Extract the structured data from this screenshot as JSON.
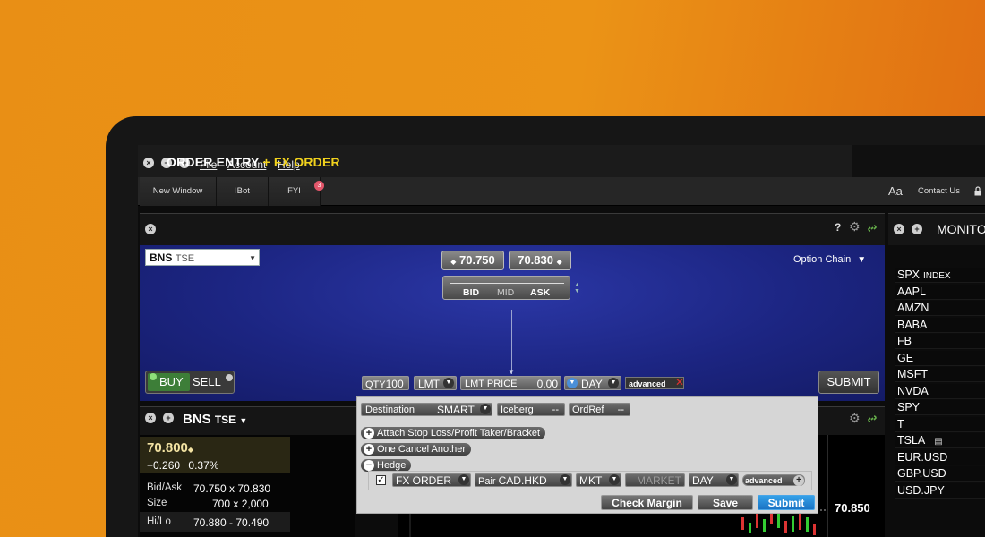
{
  "menu": {
    "file": "File",
    "account": "Account",
    "help": "Help"
  },
  "window_controls": {
    "close": "×",
    "minimize": "−",
    "maximize": "+"
  },
  "toolbar": {
    "new_window": "New Window",
    "ibot": "IBot",
    "fyi": "FYI",
    "fyi_badge": "3",
    "font_size": "Aa",
    "contact_us": "Contact Us"
  },
  "order_entry": {
    "title": "ORDER ENTRY",
    "fx_title": "+ FX ORDER",
    "help": "?",
    "symbol": "BNS",
    "exchange": "TSE",
    "bid_price": "70.750",
    "ask_price": "70.830",
    "bid_label": "BID",
    "mid_label": "MID",
    "ask_label": "ASK",
    "option_chain": "Option Chain",
    "buy": "BUY",
    "sell": "SELL",
    "qty_label": "QTY",
    "qty_value": "100",
    "order_type": "LMT",
    "lmt_price_label": "LMT PRICE",
    "lmt_price_value": "0.00",
    "tif": "DAY",
    "advanced": "advanced",
    "submit": "SUBMIT"
  },
  "quote_panel": {
    "symbol": "BNS",
    "exchange": "TSE",
    "last": "70.800",
    "change": "+0.260",
    "change_pct": "0.37%",
    "bid_ask_label": "Bid/Ask",
    "bid_ask_value": "70.750 x 70.830",
    "size_label": "Size",
    "size_value": "700 x 2,000",
    "hilo_label": "Hi/Lo",
    "hilo_value": "70.880 - 70.490",
    "chart_price": "70.850"
  },
  "advanced_panel": {
    "destination_label": "Destination",
    "destination_value": "SMART",
    "iceberg_label": "Iceberg",
    "iceberg_value": "--",
    "ordref_label": "OrdRef",
    "ordref_value": "--",
    "attach_bracket": "Attach Stop Loss/Profit Taker/Bracket",
    "one_cancel_another": "One Cancel Another",
    "hedge": "Hedge",
    "hedge_type": "FX ORDER",
    "pair_label": "Pair",
    "pair_value": "CAD.HKD",
    "hedge_order_type": "MKT",
    "hedge_price": "MARKET",
    "hedge_tif": "DAY",
    "hedge_advanced": "advanced",
    "check_margin": "Check Margin",
    "save": "Save",
    "submit": "Submit"
  },
  "monitor": {
    "title": "MONITO",
    "rows": [
      {
        "symbol": "SPX",
        "sub": "INDEX"
      },
      {
        "symbol": "AAPL"
      },
      {
        "symbol": "AMZN"
      },
      {
        "symbol": "BABA"
      },
      {
        "symbol": "FB"
      },
      {
        "symbol": "GE"
      },
      {
        "symbol": "MSFT"
      },
      {
        "symbol": "NVDA"
      },
      {
        "symbol": "SPY"
      },
      {
        "symbol": "T"
      },
      {
        "symbol": "TSLA"
      },
      {
        "symbol": "EUR.USD"
      },
      {
        "symbol": "GBP.USD"
      },
      {
        "symbol": "USD.JPY"
      }
    ]
  },
  "colors": {
    "background_orange": "#e98f15",
    "order_entry_blue": "#1c2582",
    "fx_accent": "#f1d21d",
    "buy_green": "#3d7e38",
    "submit_blue": "#1a73c4",
    "badge_red": "#e2566a"
  },
  "icons": [
    "close-icon",
    "plus-icon",
    "gear-icon",
    "link-icon",
    "lock-icon",
    "chevron-down-icon",
    "news-icon"
  ]
}
